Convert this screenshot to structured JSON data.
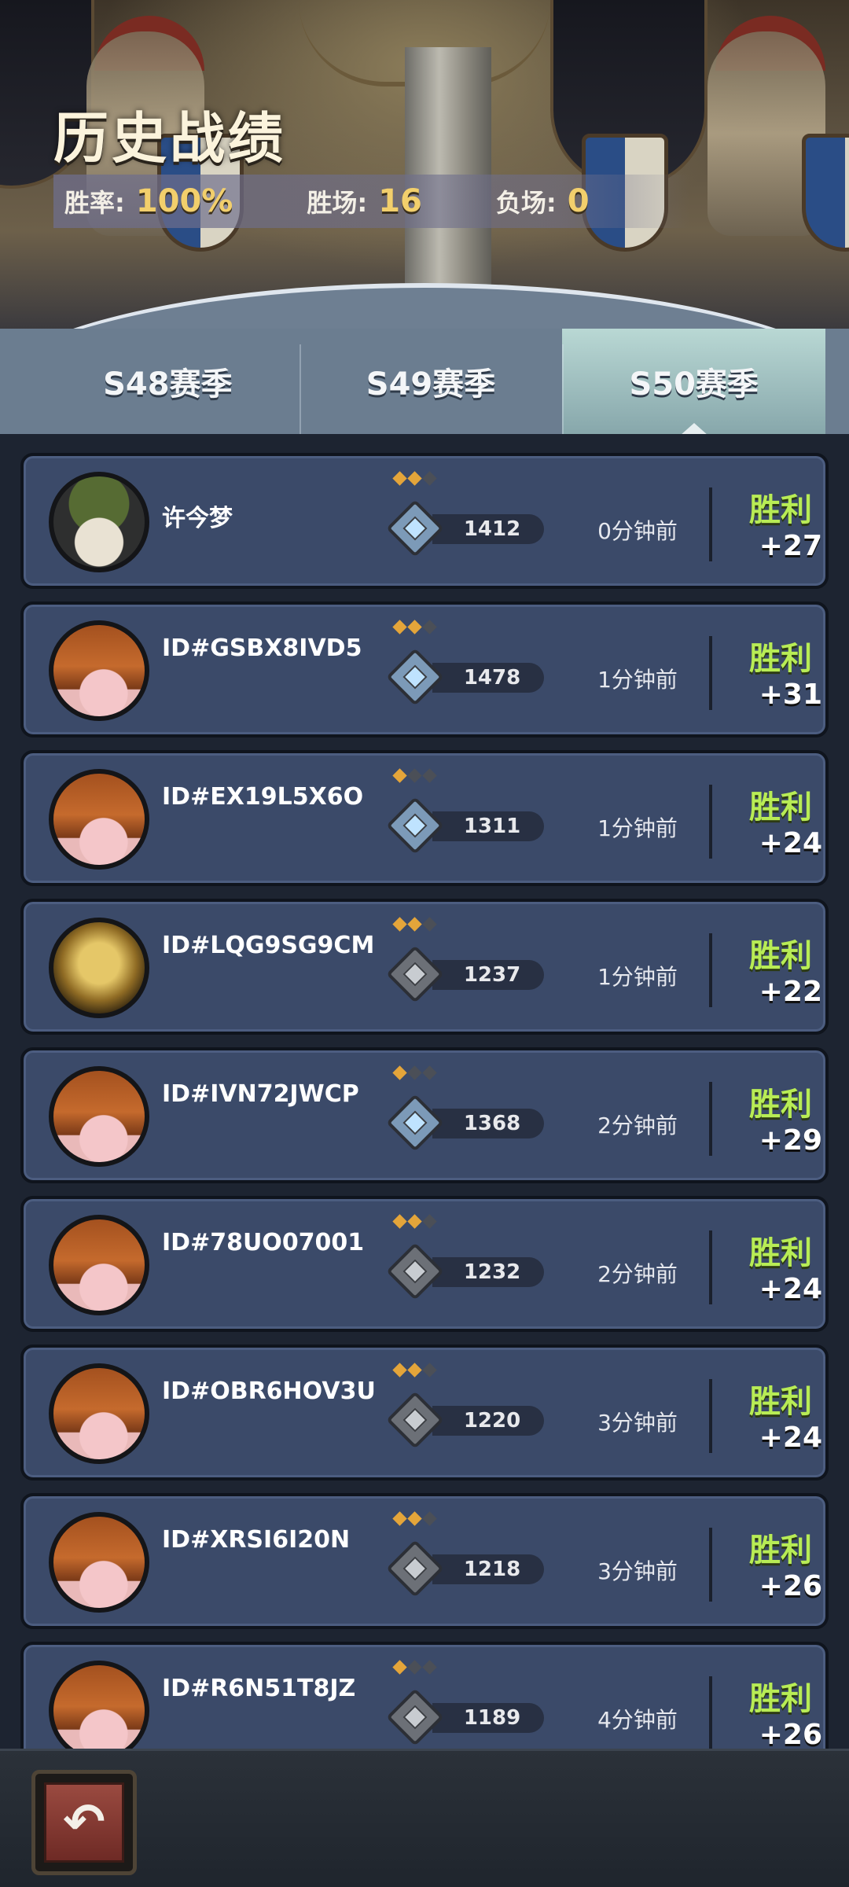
{
  "header": {
    "title": "历史战绩",
    "stats": {
      "win_rate_label": "胜率:",
      "win_rate_value": "100%",
      "wins_label": "胜场:",
      "wins_value": "16",
      "losses_label": "负场:",
      "losses_value": "0"
    }
  },
  "tabs": [
    {
      "label": "S48赛季",
      "active": false
    },
    {
      "label": "S49赛季",
      "active": false
    },
    {
      "label": "S50赛季",
      "active": true
    }
  ],
  "matches": [
    {
      "avatar": "raccoon-avatar",
      "name": "许今梦",
      "pips": 2,
      "badge": "blue",
      "score": "1412",
      "time": "0分钟前",
      "result": "胜利",
      "delta": "+27"
    },
    {
      "avatar": "pumpkin-avatar",
      "name": "ID#GSBX8IVD5",
      "pips": 2,
      "badge": "blue",
      "score": "1478",
      "time": "1分钟前",
      "result": "胜利",
      "delta": "+31"
    },
    {
      "avatar": "pumpkin-avatar",
      "name": "ID#EX19L5X6O",
      "pips": 1,
      "badge": "blue",
      "score": "1311",
      "time": "1分钟前",
      "result": "胜利",
      "delta": "+24"
    },
    {
      "avatar": "gold-avatar",
      "name": "ID#LQG9SG9CM",
      "pips": 2,
      "badge": "gray",
      "score": "1237",
      "time": "1分钟前",
      "result": "胜利",
      "delta": "+22"
    },
    {
      "avatar": "pumpkin-avatar",
      "name": "ID#IVN72JWCP",
      "pips": 1,
      "badge": "blue",
      "score": "1368",
      "time": "2分钟前",
      "result": "胜利",
      "delta": "+29"
    },
    {
      "avatar": "pumpkin-avatar",
      "name": "ID#78UO07001",
      "pips": 2,
      "badge": "gray",
      "score": "1232",
      "time": "2分钟前",
      "result": "胜利",
      "delta": "+24"
    },
    {
      "avatar": "pumpkin-avatar",
      "name": "ID#OBR6HOV3U",
      "pips": 2,
      "badge": "gray",
      "score": "1220",
      "time": "3分钟前",
      "result": "胜利",
      "delta": "+24"
    },
    {
      "avatar": "pumpkin-avatar",
      "name": "ID#XRSI6I20N",
      "pips": 2,
      "badge": "gray",
      "score": "1218",
      "time": "3分钟前",
      "result": "胜利",
      "delta": "+26"
    },
    {
      "avatar": "pumpkin-avatar",
      "name": "ID#R6N51T8JZ",
      "pips": 1,
      "badge": "gray",
      "score": "1189",
      "time": "4分钟前",
      "result": "胜利",
      "delta": "+26"
    }
  ],
  "footer": {
    "back_icon": "back-arrow-icon"
  },
  "colors": {
    "win_green": "#b8ec55",
    "gold_text": "#f2cf6c",
    "card_bg": "#3b4a69",
    "active_tab": "#b9d8d4"
  }
}
